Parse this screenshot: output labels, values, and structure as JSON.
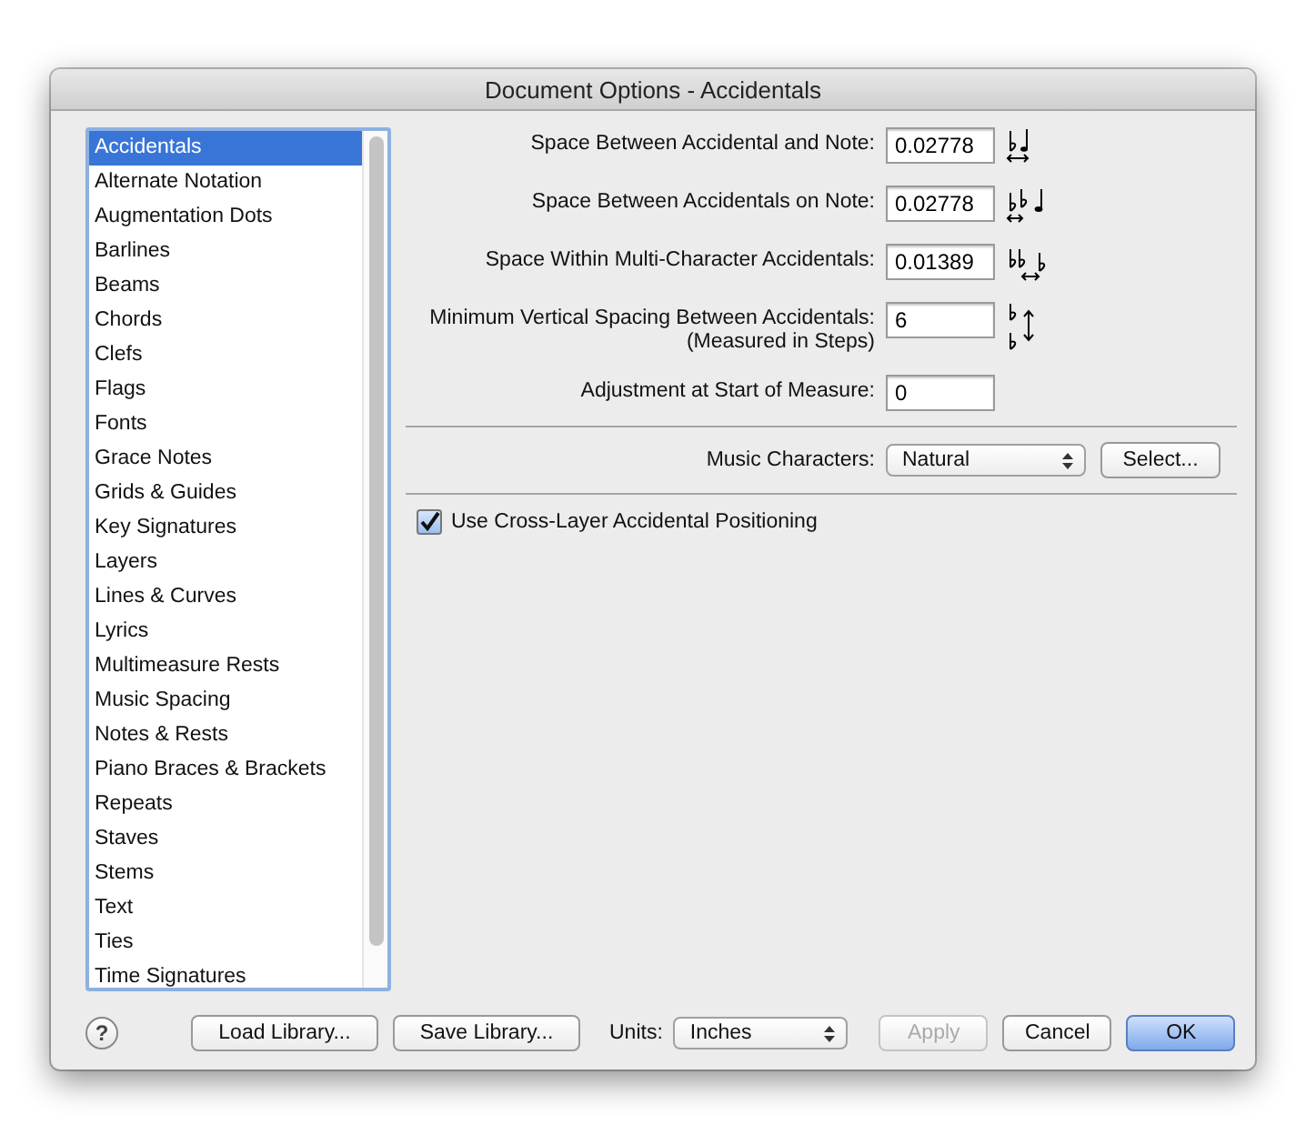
{
  "window": {
    "title": "Document Options - Accidentals"
  },
  "sidebar": {
    "items": [
      {
        "label": "Accidentals",
        "selected": true
      },
      {
        "label": "Alternate Notation",
        "selected": false
      },
      {
        "label": "Augmentation Dots",
        "selected": false
      },
      {
        "label": "Barlines",
        "selected": false
      },
      {
        "label": "Beams",
        "selected": false
      },
      {
        "label": "Chords",
        "selected": false
      },
      {
        "label": "Clefs",
        "selected": false
      },
      {
        "label": "Flags",
        "selected": false
      },
      {
        "label": "Fonts",
        "selected": false
      },
      {
        "label": "Grace Notes",
        "selected": false
      },
      {
        "label": "Grids & Guides",
        "selected": false
      },
      {
        "label": "Key Signatures",
        "selected": false
      },
      {
        "label": "Layers",
        "selected": false
      },
      {
        "label": "Lines & Curves",
        "selected": false
      },
      {
        "label": "Lyrics",
        "selected": false
      },
      {
        "label": "Multimeasure Rests",
        "selected": false
      },
      {
        "label": "Music Spacing",
        "selected": false
      },
      {
        "label": "Notes & Rests",
        "selected": false
      },
      {
        "label": "Piano Braces & Brackets",
        "selected": false
      },
      {
        "label": "Repeats",
        "selected": false
      },
      {
        "label": "Staves",
        "selected": false
      },
      {
        "label": "Stems",
        "selected": false
      },
      {
        "label": "Text",
        "selected": false
      },
      {
        "label": "Ties",
        "selected": false
      },
      {
        "label": "Time Signatures",
        "selected": false
      }
    ]
  },
  "settings": [
    {
      "label": "Space Between Accidental and Note:",
      "value": "0.02778"
    },
    {
      "label": "Space Between Accidentals on Note:",
      "value": "0.02778"
    },
    {
      "label": "Space Within Multi-Character Accidentals:",
      "value": "0.01389"
    },
    {
      "label": "Minimum Vertical Spacing Between Accidentals:",
      "note": "(Measured in Steps)",
      "value": "6"
    },
    {
      "label": "Adjustment at Start of Measure:",
      "value": "0"
    }
  ],
  "music_characters": {
    "label": "Music Characters:",
    "value": "Natural",
    "button": "Select..."
  },
  "cross_layer": {
    "label": "Use Cross-Layer Accidental Positioning",
    "checked": true
  },
  "footer": {
    "help": "?",
    "load": "Load Library...",
    "save": "Save Library...",
    "units_label": "Units:",
    "units_value": "Inches",
    "actions": [
      {
        "label": "Apply",
        "disabled": true,
        "default": false
      },
      {
        "label": "Cancel",
        "disabled": false,
        "default": false
      },
      {
        "label": "OK",
        "disabled": false,
        "default": true
      }
    ]
  }
}
